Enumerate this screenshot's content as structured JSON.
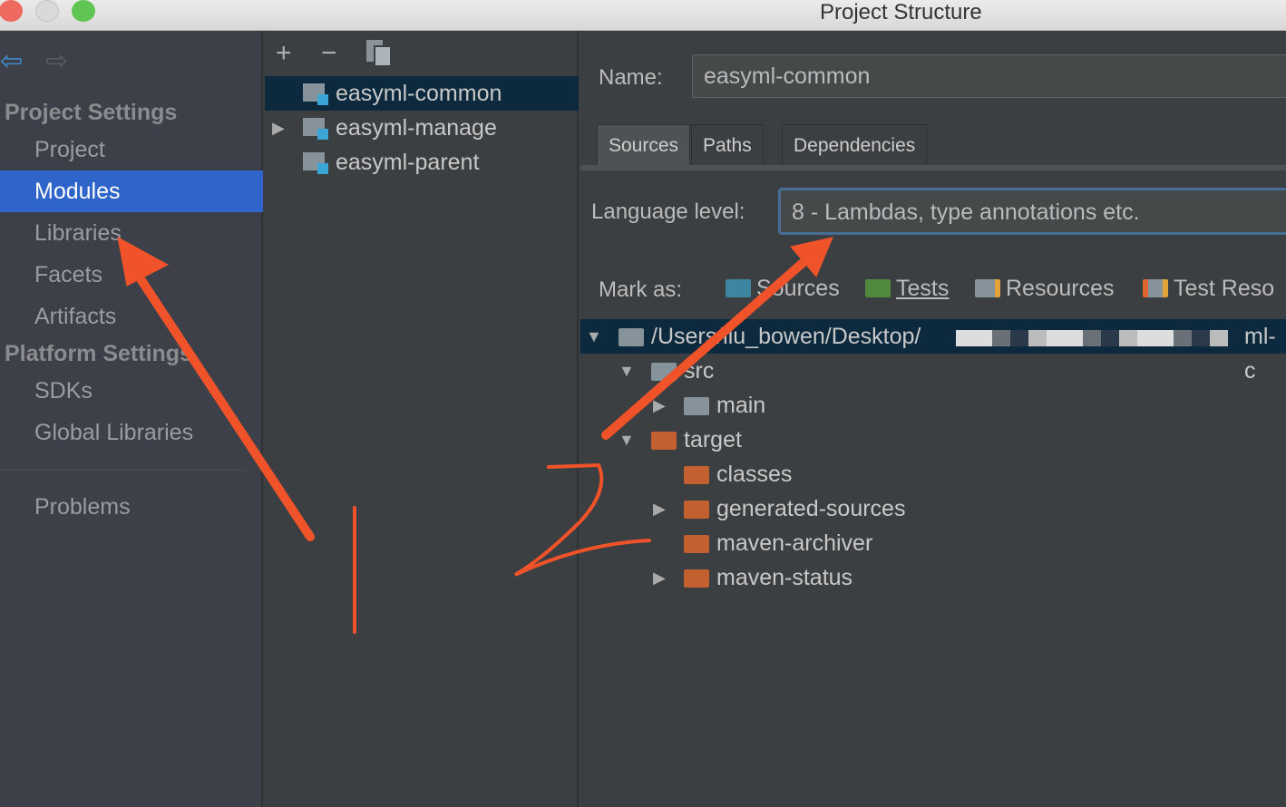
{
  "window": {
    "title": "Project Structure"
  },
  "sidebar": {
    "sections": [
      {
        "label": "Project Settings"
      },
      {
        "label": "Platform Settings"
      }
    ],
    "items": [
      {
        "label": "Project"
      },
      {
        "label": "Modules",
        "selected": true
      },
      {
        "label": "Libraries"
      },
      {
        "label": "Facets"
      },
      {
        "label": "Artifacts"
      },
      {
        "label": "SDKs"
      },
      {
        "label": "Global Libraries"
      },
      {
        "label": "Problems"
      }
    ]
  },
  "modules": {
    "toolbar": {
      "add": "+",
      "remove": "−"
    },
    "items": [
      {
        "label": "easyml-common",
        "selected": true
      },
      {
        "label": "easyml-manage"
      },
      {
        "label": "easyml-parent"
      }
    ]
  },
  "detail": {
    "name_label": "Name:",
    "name_value": "easyml-common",
    "tabs": [
      {
        "label": "Sources",
        "selected": true
      },
      {
        "label": "Paths"
      },
      {
        "label": "Dependencies"
      }
    ],
    "language_label": "Language level:",
    "language_value": "8 - Lambdas, type annotations etc.",
    "mark_label": "Mark as:",
    "mark": [
      {
        "label": "Sources",
        "color": "#3e86a0"
      },
      {
        "label": "Tests",
        "color": "#4f8a3e"
      },
      {
        "label": "Resources",
        "color": "#87939a"
      },
      {
        "label": "Test Reso",
        "color": "#87939a"
      }
    ],
    "tree": [
      {
        "label": "/Users/liu_bowen/Desktop/",
        "suffix": "ml-c",
        "selected": true
      },
      {
        "label": "src"
      },
      {
        "label": "main"
      },
      {
        "label": "target"
      },
      {
        "label": "classes"
      },
      {
        "label": "generated-sources"
      },
      {
        "label": "maven-archiver"
      },
      {
        "label": "maven-status"
      }
    ]
  },
  "annotations": {
    "color": "#f0522a",
    "mark1": "1",
    "mark2": "2"
  }
}
